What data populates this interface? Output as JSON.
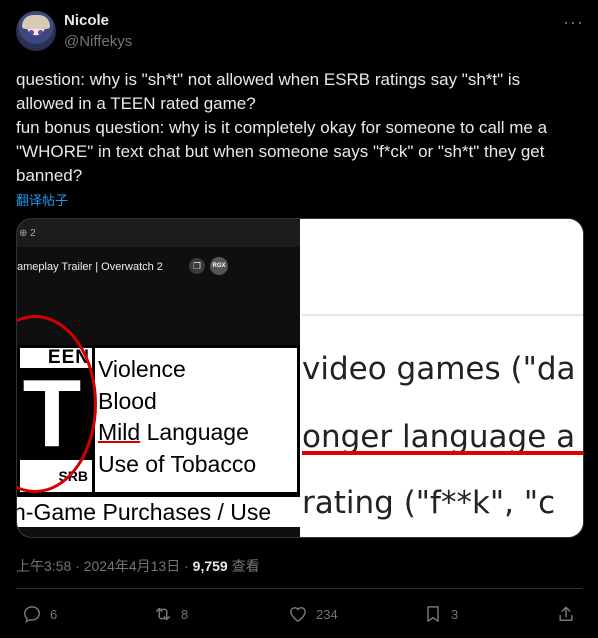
{
  "author": {
    "name": "Nicole",
    "handle": "@Niffekys"
  },
  "tweet": {
    "paragraphs": [
      "question: why is \"sh*t\" not allowed when ESRB ratings say \"sh*t\" is allowed in a TEEN rated game?",
      "fun bonus question: why is it completely okay for someone to call me a \"WHORE\" in text chat but when someone says \"f*ck\" or \"sh*t\" they get banned?"
    ],
    "translate_label": "翻译帖子"
  },
  "media": {
    "left": {
      "tab_text": "⊕ 2",
      "video_title": "ameplay Trailer | Overwatch 2",
      "rgx_badge": "RGX",
      "rating_top": "EEN",
      "rating_letter": "T",
      "rating_bottom": "SRB",
      "descriptors": [
        "Violence",
        "Blood",
        "Language",
        "Use of Tobacco"
      ],
      "mild_word": "Mild",
      "purchases_text": "n-Game Purchases / Use"
    },
    "right": {
      "line1": "video games (\"da",
      "line2": "onger language a",
      "line3": "rating (\"f**k\", \"c"
    }
  },
  "meta": {
    "time": "上午3:58",
    "date": "2024年4月13日",
    "views": "9,759",
    "views_label": "查看",
    "separator": "·"
  },
  "actions": {
    "replies": "6",
    "reposts": "8",
    "likes": "234",
    "bookmarks": "3"
  },
  "colors": {
    "background": "#000000",
    "text": "#e7e9ea",
    "muted": "#71767b",
    "link": "#1d9bf0",
    "highlight_red": "#d40000"
  }
}
